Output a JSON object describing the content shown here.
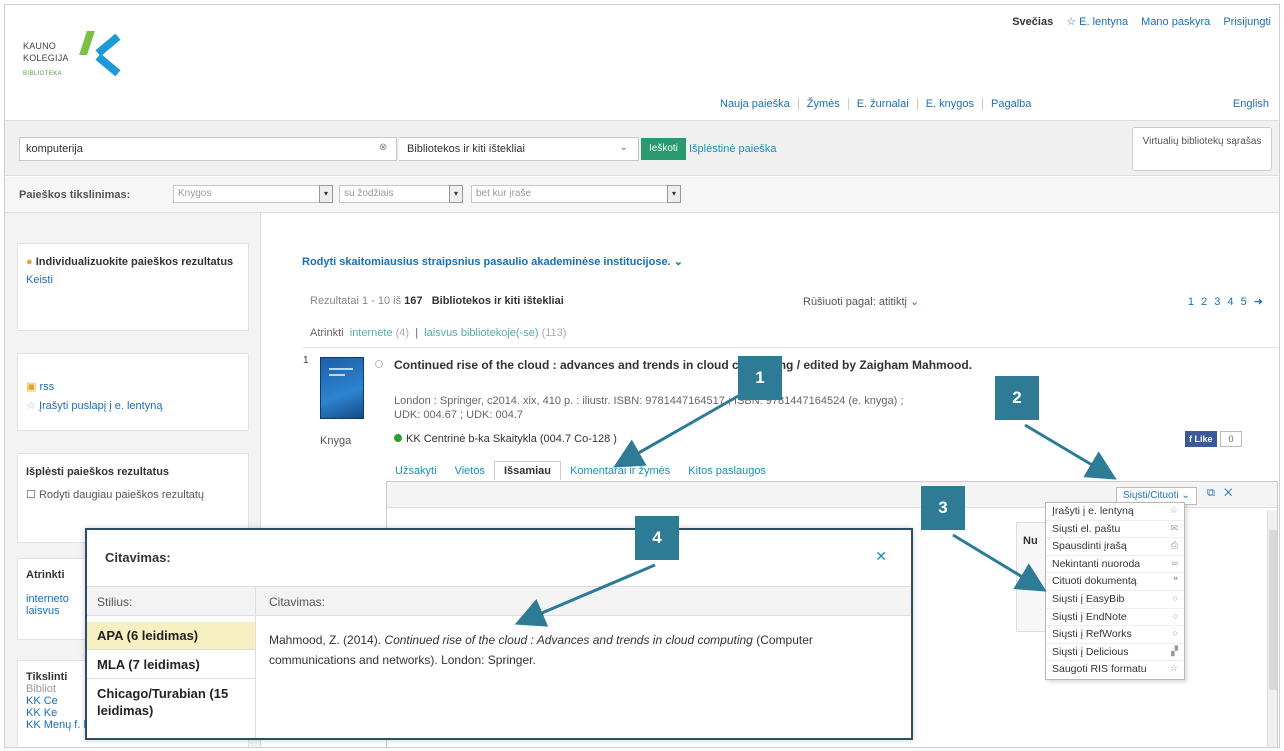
{
  "header": {
    "user_links": [
      "Svečias",
      "☆ E. lentyna",
      "Mano paskyra",
      "Prisijungti"
    ],
    "logo": {
      "line1": "KAUNO",
      "line2": "KOLEGIJA",
      "line3": "BIBLIOTEKA"
    },
    "nav": [
      "Nauja paieška",
      "Žymės",
      "E. žurnalai",
      "E. knygos",
      "Pagalba"
    ],
    "language": "English"
  },
  "search": {
    "query": "komputerija",
    "scope": "Bibliotekos ir kiti ištekliai",
    "button": "Ieškoti",
    "advanced": "Išplėstinė paieška",
    "virtual_library": "Virtualių bibliotekų sąrašas"
  },
  "refine": {
    "label": "Paieškos tikslinimas:",
    "type": "Knygos",
    "match": "su žodžiais",
    "field": "bet kur įraše"
  },
  "sidebar": {
    "personalize_title": "Individualizuokite paieškos rezultatus",
    "personalize_link": "Keisti",
    "rss": "rss",
    "save_page": "Įrašyti puslapį į e. lentyną",
    "expand_title": "Išplėsti paieškos rezultatus",
    "expand_option": "Rodyti daugiau paieškos rezultatų",
    "filter_title": "Atrinkti",
    "filter_items": [
      "interneto",
      "laisvus"
    ],
    "narrow_title": "Tikslinti",
    "narrow_items": [
      "Bibliot",
      "KK Ce",
      "KK Ke",
      "KK Menų f. b-ka"
    ]
  },
  "results": {
    "show_most_cited": "Rodyti skaitomiausius straipsnius pasaulio akademinėse institucijose.",
    "range": "Rezultatai 1 - 10 iš",
    "total": "167",
    "scope": "Bibliotekos ir kiti ištekliai",
    "sort_label": "Rūšiuoti pagal:",
    "sort_value": "atitiktį",
    "pages": "1 2 3 4 5 ➜",
    "filter_label": "Atrinkti",
    "filter_online": "internete",
    "filter_online_count": "(4)",
    "filter_available": "laisvus bibliotekoje(-se)",
    "filter_available_count": "(113)"
  },
  "record": {
    "number": "1",
    "title": "Continued rise of the cloud : advances and trends in cloud computing / edited by Zaigham Mahmood.",
    "info": "London : Springer, c2014. xix, 410 p. : iliustr. ISBN: 9781447164517 ; ISBN: 9781447164524 (e. knyga) ;",
    "udk": "UDK: 004.67 ; UDK: 004.7",
    "type": "Knyga",
    "location": "KK Centrinė b-ka Skaitykla (004.7 Co-128 )",
    "like": "Like",
    "like_count": "0"
  },
  "tabs": [
    "Užsakyti",
    "Vietos",
    "Išsamiau",
    "Komentarai ir žymės",
    "Kitos paslaugos"
  ],
  "panel": {
    "send_cite": "Siųsti/Cituoti",
    "nu_label": "Nu"
  },
  "send_menu": [
    {
      "label": "Įrašyti į e. lentyną",
      "icon": "☆"
    },
    {
      "label": "Siųsti el. paštu",
      "icon": "✉"
    },
    {
      "label": "Spausdinti įrašą",
      "icon": "⎙"
    },
    {
      "label": "Nekintanti nuoroda",
      "icon": "∞"
    },
    {
      "label": "Cituoti dokumentą",
      "icon": "❝"
    },
    {
      "label": "Siųsti į EasyBib",
      "icon": "○"
    },
    {
      "label": "Siųsti į EndNote",
      "icon": "○"
    },
    {
      "label": "Siųsti į RefWorks",
      "icon": "○"
    },
    {
      "label": "Siųsti į Delicious",
      "icon": "▞"
    },
    {
      "label": "Saugoti RIS formatu",
      "icon": "☆"
    }
  ],
  "cite_dialog": {
    "title": "Citavimas:",
    "style_header": "Stilius:",
    "citation_header": "Citavimas:",
    "styles": [
      "APA (6 leidimas)",
      "MLA (7 leidimas)",
      "Chicago/Turabian (15 leidimas)"
    ],
    "citation_prefix": "Mahmood, Z. (2014).",
    "citation_title": "Continued rise of the cloud : Advances and trends in cloud computing",
    "citation_suffix": "(Computer communications and networks). London: Springer."
  },
  "callouts": [
    "1",
    "2",
    "3",
    "4"
  ],
  "colors": {
    "callout": "#2e7b95",
    "accent": "#1a6fb5",
    "highlight": "#f6efc2"
  }
}
